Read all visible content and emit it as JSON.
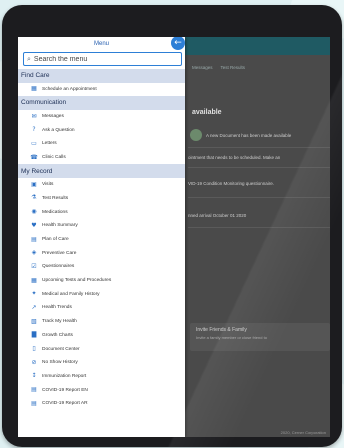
{
  "menu": {
    "title": "Menu",
    "back_icon": "arrow-left-icon",
    "search": {
      "placeholder": "Search the menu"
    },
    "sections": [
      {
        "label": "Find Care",
        "items": [
          {
            "label": "Schedule an Appointment",
            "icon": "calendar-icon"
          }
        ]
      },
      {
        "label": "Communication",
        "items": [
          {
            "label": "Messages",
            "icon": "envelope-icon"
          },
          {
            "label": "Ask a Question",
            "icon": "question-bubble-icon"
          },
          {
            "label": "Letters",
            "icon": "letter-icon"
          },
          {
            "label": "Clinic Calls",
            "icon": "phone-icon"
          }
        ]
      },
      {
        "label": "My Record",
        "items": [
          {
            "label": "Visits",
            "icon": "visit-icon"
          },
          {
            "label": "Test Results",
            "icon": "flask-icon"
          },
          {
            "label": "Medications",
            "icon": "pill-icon"
          },
          {
            "label": "Health Summary",
            "icon": "heart-icon"
          },
          {
            "label": "Plan of Care",
            "icon": "clipboard-icon"
          },
          {
            "label": "Preventive Care",
            "icon": "shield-icon"
          },
          {
            "label": "Questionnaires",
            "icon": "checklist-icon"
          },
          {
            "label": "Upcoming Tests and Procedures",
            "icon": "calendar-check-icon"
          },
          {
            "label": "Medical and Family History",
            "icon": "family-icon"
          },
          {
            "label": "Health Trends",
            "icon": "trend-icon"
          },
          {
            "label": "Track My Health",
            "icon": "tracker-icon"
          },
          {
            "label": "Growth Charts",
            "icon": "growth-chart-icon"
          },
          {
            "label": "Document Center",
            "icon": "document-icon"
          },
          {
            "label": "No Show History",
            "icon": "no-show-icon"
          },
          {
            "label": "Immunization Report",
            "icon": "syringe-icon"
          },
          {
            "label": "COVID-19 Report EN",
            "icon": "report-icon"
          },
          {
            "label": "COVID-19 Report AR",
            "icon": "report-icon"
          }
        ]
      }
    ]
  },
  "background_app": {
    "nav": [
      "Messages",
      "Test Results"
    ],
    "heading": "available",
    "lines": [
      "A new Document has been made available",
      "ointment that needs to be scheduled. Make an",
      "VID-19 Condition Monitoring questionnaire.",
      "nned arrival October 01 2020"
    ],
    "card": {
      "title": "Invite Friends & Family",
      "subtitle": "Invite a family member or close friend to"
    },
    "footer": "2020, Cerner Corporation"
  },
  "colors": {
    "accent": "#2d7fd6",
    "section_bg": "#d3dcec",
    "header_teal": "#1f5a63"
  }
}
